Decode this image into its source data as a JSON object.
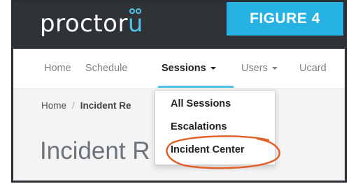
{
  "header": {
    "logo_prefix": "proctor",
    "logo_suffix": "u",
    "figure_label": "FIGURE 4"
  },
  "nav": {
    "items": [
      {
        "label": "Home"
      },
      {
        "label": "Schedule"
      },
      {
        "label": "Sessions"
      },
      {
        "label": "Users"
      },
      {
        "label": "Ucard"
      }
    ],
    "active": "Sessions"
  },
  "breadcrumb": {
    "home": "Home",
    "separator": "/",
    "current_partial": "Incident Re"
  },
  "page_title": {
    "visible_start": "Incident R",
    "visible_end": "r"
  },
  "dropdown": {
    "items": [
      {
        "label": "All Sessions"
      },
      {
        "label": "Escalations"
      },
      {
        "label": "Incident Center"
      }
    ],
    "highlighted": "Incident Center"
  },
  "colors": {
    "header_bg": "#2f3237",
    "accent": "#4fc3e8",
    "badge_bg": "#27b2e4",
    "annotation": "#e0622a"
  },
  "icons": {
    "logo_mark": "owl-eyes-icon",
    "menu_caret": "caret-down-icon"
  }
}
